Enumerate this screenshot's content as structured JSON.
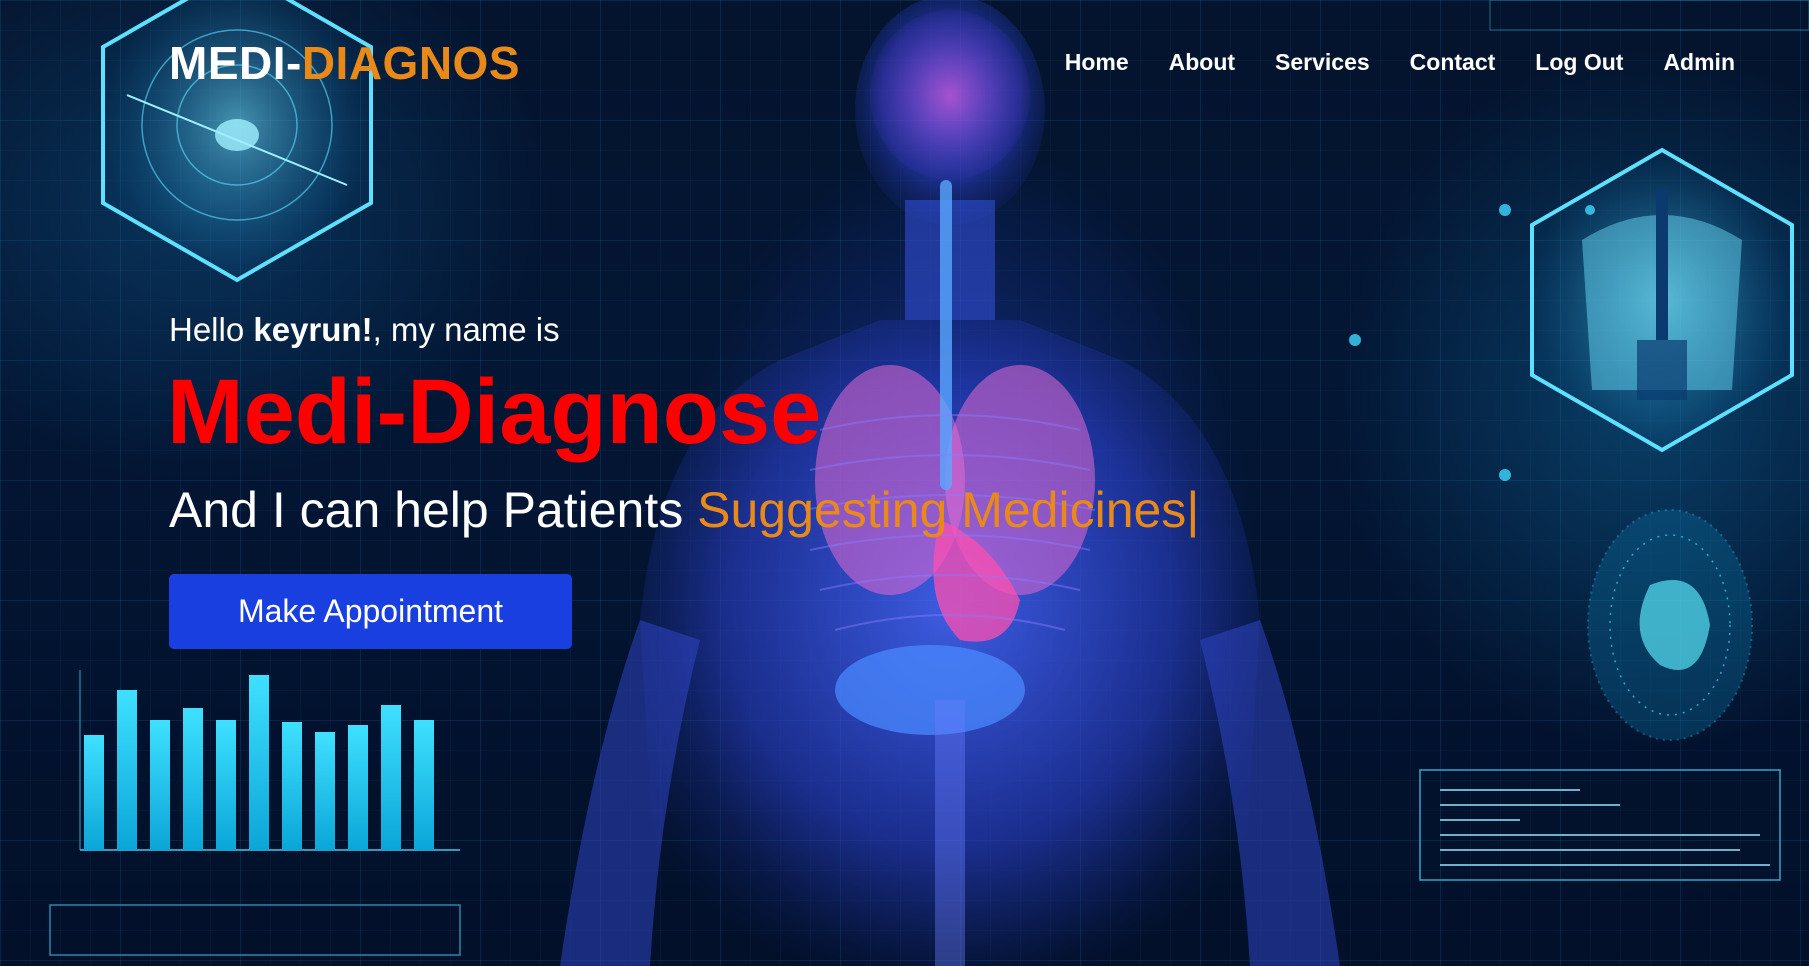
{
  "brand": {
    "part1": "MEDI-",
    "part2": "DIAGNOS"
  },
  "nav": {
    "items": [
      "Home",
      "About",
      "Services",
      "Contact",
      "Log Out",
      "Admin"
    ]
  },
  "hero": {
    "greeting_prefix": "Hello ",
    "username": "keyrun!",
    "greeting_suffix": ", my name is",
    "title": "Medi-Diagnose",
    "tagline_prefix": "And I can help Patients ",
    "tagline_highlight": "Suggesting Medicines",
    "cursor": "|",
    "cta_label": "Make Appointment"
  },
  "colors": {
    "accent_orange": "#e8891a",
    "title_red": "#ff0000",
    "button_blue": "#1a3fe0",
    "background": "#031634"
  }
}
